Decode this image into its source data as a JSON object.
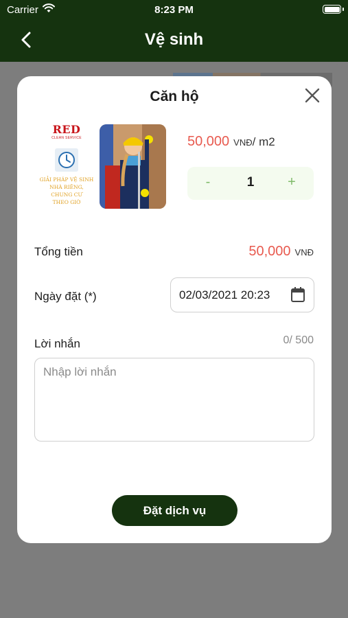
{
  "status_bar": {
    "carrier": "Carrier",
    "time": "8:23 PM"
  },
  "navbar": {
    "title": "Vệ sinh",
    "back_icon": "chevron-left-icon"
  },
  "modal": {
    "title": "Căn hộ",
    "close_icon": "close-icon",
    "promo_image": {
      "brand": "RED",
      "brand_sub": "CLEAN SERVICE",
      "tagline_lines": [
        "GIẢI PHÁP VỆ SINH",
        "NHÀ RIÊNG,",
        "CHUNG CƯ",
        "THEO GIỜ"
      ]
    },
    "price": {
      "amount": "50,000",
      "currency": "VNĐ",
      "unit": "/ m2"
    },
    "quantity": {
      "minus": "-",
      "value": "1",
      "plus": "+"
    },
    "total": {
      "label": "Tổng tiền",
      "amount": "50,000",
      "currency": "VNĐ"
    },
    "date": {
      "label": "Ngày đặt (*)",
      "value": "02/03/2021 20:23",
      "icon": "calendar-icon"
    },
    "message": {
      "label": "Lời nhắn",
      "counter": "0/ 500",
      "placeholder": "Nhập lời nhắn"
    },
    "submit_label": "Đặt dịch vụ"
  },
  "colors": {
    "header_bg": "#15330f",
    "price_red": "#e85a4f",
    "stepper_bg": "#f4fbef",
    "stepper_accent": "#7fbb6a",
    "overlay": "#7d7d7d"
  }
}
